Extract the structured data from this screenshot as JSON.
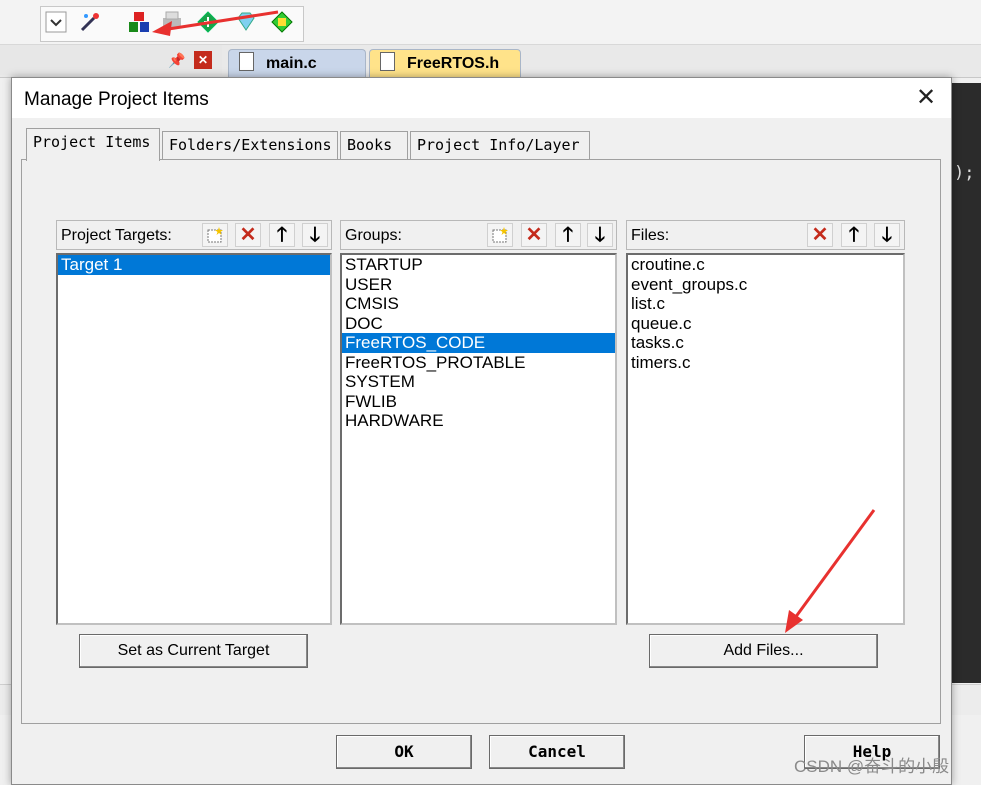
{
  "ide": {
    "tabs": [
      {
        "label": "main.c"
      },
      {
        "label": "FreeRTOS.h"
      }
    ],
    "editor_snippet": ");"
  },
  "dialog": {
    "title": "Manage Project Items",
    "tabs": [
      {
        "label": "Project Items"
      },
      {
        "label": "Folders/Extensions"
      },
      {
        "label": "Books"
      },
      {
        "label": "Project Info/Layer"
      }
    ],
    "targets": {
      "label": "Project Targets:",
      "items": [
        "Target 1"
      ],
      "selected": "Target 1"
    },
    "groups": {
      "label": "Groups:",
      "items": [
        "STARTUP",
        "USER",
        "CMSIS",
        "DOC",
        "FreeRTOS_CODE",
        "FreeRTOS_PROTABLE",
        "SYSTEM",
        "FWLIB",
        "HARDWARE"
      ],
      "selected": "FreeRTOS_CODE"
    },
    "files": {
      "label": "Files:",
      "items": [
        "croutine.c",
        "event_groups.c",
        "list.c",
        "queue.c",
        "tasks.c",
        "timers.c"
      ]
    },
    "buttons": {
      "set_current_target": "Set as Current Target",
      "add_files": "Add Files...",
      "ok": "OK",
      "cancel": "Cancel",
      "help": "Help"
    }
  },
  "watermark": "CSDN @奋斗的小殷",
  "colors": {
    "selection": "#0078d7",
    "delete_red": "#c42b1c",
    "arrow_red": "#e8312f"
  }
}
